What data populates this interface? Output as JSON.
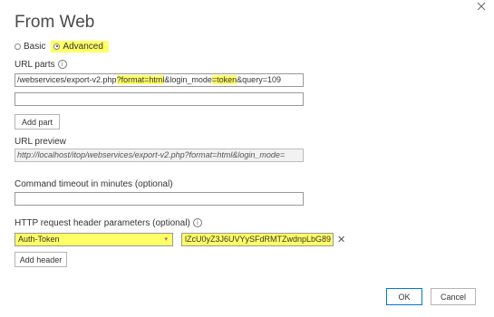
{
  "dialog": {
    "title": "From Web",
    "mode_options": [
      {
        "label": "Basic",
        "selected": false
      },
      {
        "label": "Advanced",
        "selected": true
      }
    ],
    "url_parts_label": "URL parts",
    "url_parts": {
      "part1": "/webservices/export-v2.php?format=html&login_mode=token&query=109",
      "part1_segments": [
        "/webservices/export-v2.php",
        "?format=html",
        "&login_mode",
        "=token",
        "&query=109"
      ],
      "part2": ""
    },
    "add_part_label": "Add part",
    "url_preview_label": "URL preview",
    "url_preview_value": "http://localhost/itop/webservices/export-v2.php?format=html&login_mode=",
    "timeout_label": "Command timeout in minutes (optional)",
    "timeout_value": "",
    "header_params_label": "HTTP request header parameters (optional)",
    "header_name": "Auth-Token",
    "header_value": "lZcU0yZ3J6UVYySFdRMTZwdnpLbG89",
    "add_header_label": "Add header",
    "ok_label": "OK",
    "cancel_label": "Cancel",
    "highlight_color": "#ffff66"
  }
}
